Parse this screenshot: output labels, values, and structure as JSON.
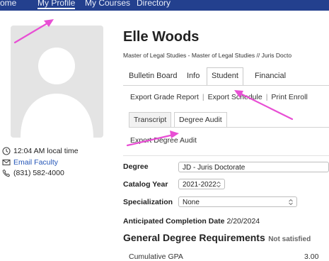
{
  "nav": {
    "items": [
      "ome",
      "My Profile",
      "My Courses",
      "Directory"
    ]
  },
  "profile": {
    "name": "Elle Woods",
    "programs": "Master of Legal Studies - Master of Legal Studies // Juris Docto",
    "local_time": "12:04 AM local time",
    "email_link": "Email Faculty",
    "phone": "(831) 582-4000"
  },
  "tabs": [
    "Bulletin Board",
    "Info",
    "Student",
    "Financial"
  ],
  "actions": {
    "export_grade": "Export Grade Report",
    "export_schedule": "Export Schedule",
    "print_enroll": "Print Enroll"
  },
  "subtabs": [
    "Transcript",
    "Degree Audit"
  ],
  "export_audit": "Export Degree Audit",
  "form": {
    "degree_label": "Degree",
    "degree_value": "JD - Juris Doctorate",
    "catalog_label": "Catalog Year",
    "catalog_value": "2021-2022",
    "spec_label": "Specialization",
    "spec_value": "None",
    "anticipated_label": "Anticipated Completion Date",
    "anticipated_value": "2/20/2024"
  },
  "requirements": {
    "title": "General Degree Requirements",
    "status": "Not satisfied",
    "cut_row_label": "Cumulative GPA",
    "cut_row_value": "3.00"
  },
  "colors": {
    "nav_bg": "#23408e",
    "link": "#2456b8",
    "annotation": "#e84fd4"
  }
}
